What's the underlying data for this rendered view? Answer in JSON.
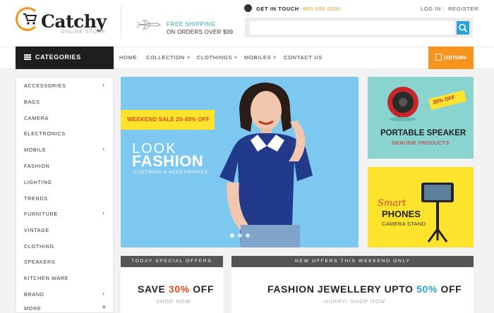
{
  "header": {
    "brand": "Catchy",
    "brand_tagline": "ONLINE STORE",
    "shipping_line1": "FREE SHIPPING",
    "shipping_line2": "ON ORDERS OVER $99",
    "get_in_touch": "GET IN TOUCH",
    "phone": "-800 000 0000",
    "login": "LOG IN",
    "register": "REGISTER",
    "search_placeholder": "",
    "search_value": ""
  },
  "nav": {
    "categories_label": "CATEGORIES",
    "items": [
      {
        "label": "HOME"
      },
      {
        "label": "COLLECTION ˅"
      },
      {
        "label": "CLOTHINGS ˅"
      },
      {
        "label": "MOBILES ˅"
      },
      {
        "label": "CONTACT US"
      }
    ],
    "cart_label": "(0)ITEMS"
  },
  "sidebar": {
    "items": [
      {
        "label": "ACCESSORIES",
        "icon": "chevron-right"
      },
      {
        "label": "BAGS"
      },
      {
        "label": "CAMERA"
      },
      {
        "label": "ELECTRONICS"
      },
      {
        "label": "MOBILE",
        "icon": "chevron-right"
      },
      {
        "label": "FASHION"
      },
      {
        "label": "LIGHTING"
      },
      {
        "label": "TRENDS"
      },
      {
        "label": "FURNITURE",
        "icon": "chevron-right"
      },
      {
        "label": "VINTAGE"
      },
      {
        "label": "CLOTHING"
      },
      {
        "label": "SPEAKERS"
      },
      {
        "label": "KITCHEN WARE"
      },
      {
        "label": "BRAND",
        "icon": "chevron-right"
      },
      {
        "label": "MORE",
        "icon": "plus"
      }
    ]
  },
  "hero": {
    "sale_tag": "WEEKEND SALE 20-45% OFF",
    "title_line1": "LOOK",
    "title_line2": "FASHION",
    "subtitle": "CLOTHING & ACCESSORIES"
  },
  "banners": {
    "speaker": {
      "discount": "20% OFF",
      "title": "PORTABLE SPEAKER",
      "subtitle": "GENUINE PRODUCTS"
    },
    "phones": {
      "line1": "Smart",
      "line2": "PHONES",
      "line3": "CAMERA STAND"
    }
  },
  "promos": {
    "left": {
      "header": "TODAY SPECIAL OFFERS",
      "pre": "SAVE ",
      "highlight": "30%",
      "post": " OFF",
      "cta": "SHOP NOW"
    },
    "right": {
      "header": "NEW OFFERS THIS WEEKEND ONLY",
      "pre": "FASHION JEWELLERY UPTO ",
      "highlight": "50%",
      "post": " OFF",
      "cta": "HURRY! SHOP NOW"
    }
  },
  "colors": {
    "accent": "#f7941d",
    "blue": "#2aa3d9",
    "dark": "#1e1e1e"
  }
}
